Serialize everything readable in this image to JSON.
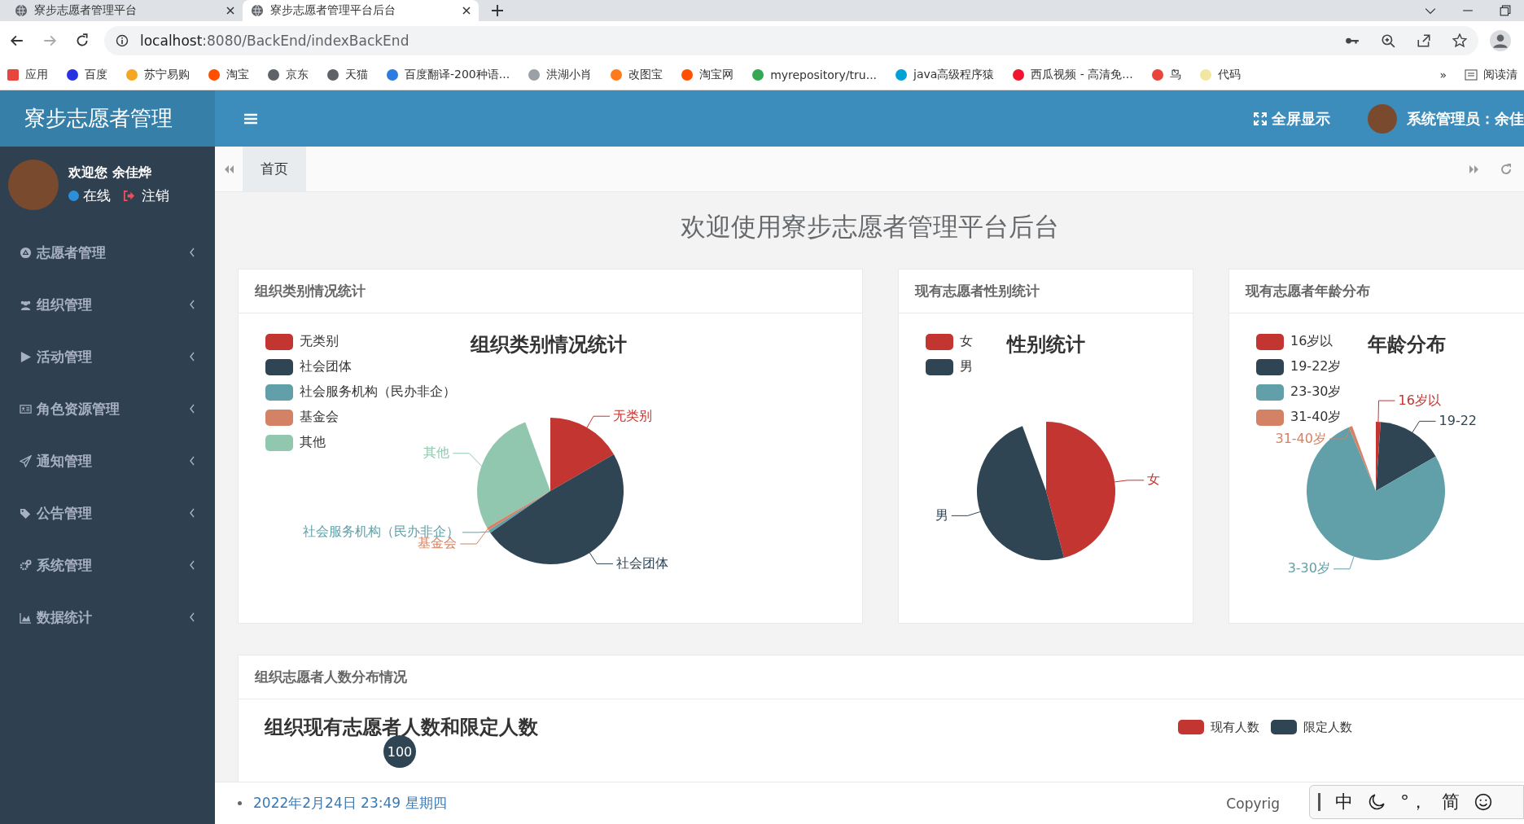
{
  "browser": {
    "tabs": [
      {
        "title": "寮步志愿者管理平台",
        "selected": false
      },
      {
        "title": "寮步志愿者管理平台后台",
        "selected": true
      }
    ],
    "url_host": "localhost",
    "url_rest": ":8080/BackEnd/indexBackEnd",
    "bookmarks": [
      {
        "label": "应用",
        "color": "#e8453c"
      },
      {
        "label": "百度",
        "color": "#2932e1"
      },
      {
        "label": "苏宁易购",
        "color": "#f5a623"
      },
      {
        "label": "淘宝",
        "color": "#ff5000"
      },
      {
        "label": "京东",
        "color": "#5f6368"
      },
      {
        "label": "天猫",
        "color": "#5f6368"
      },
      {
        "label": "百度翻译-200种语...",
        "color": "#2b7be0"
      },
      {
        "label": "洪湖小肖",
        "color": "#9aa0a6"
      },
      {
        "label": "改图宝",
        "color": "#ff7a1a"
      },
      {
        "label": "淘宝网",
        "color": "#ff5000"
      },
      {
        "label": "myrepository/tru...",
        "color": "#34a853"
      },
      {
        "label": "java高级程序猿",
        "color": "#00a1d6"
      },
      {
        "label": "西瓜视频 - 高清免...",
        "color": "#f0142f"
      },
      {
        "label": "鸟",
        "color": "#e8453c"
      },
      {
        "label": "代码",
        "color": "#f2e6a0"
      }
    ],
    "bookmarks_more": "»",
    "reading_list": "阅读清"
  },
  "app": {
    "logo": "寮步志愿者管理",
    "fullscreen": "全屏显示",
    "admin": "系统管理员：余佳"
  },
  "user": {
    "greeting": "欢迎您 余佳烨",
    "status": "在线",
    "logout": "注销"
  },
  "menu": [
    {
      "label": "志愿者管理"
    },
    {
      "label": "组织管理"
    },
    {
      "label": "活动管理"
    },
    {
      "label": "角色资源管理"
    },
    {
      "label": "通知管理"
    },
    {
      "label": "公告管理"
    },
    {
      "label": "系统管理"
    },
    {
      "label": "数据统计"
    }
  ],
  "page_tabs": [
    {
      "label": "首页",
      "selected": true
    }
  ],
  "welcome": "欢迎使用寮步志愿者管理平台后台",
  "pie_cards": [
    {
      "header": "组织类别情况统计",
      "chart_title": "组织类别情况统计",
      "legend": [
        {
          "label": "无类别",
          "color": "#c23531"
        },
        {
          "label": "社会团体",
          "color": "#2f4554"
        },
        {
          "label": "社会服务机构（民办非企）",
          "color": "#61a0a8"
        },
        {
          "label": "基金会",
          "color": "#d48265"
        },
        {
          "label": "其他",
          "color": "#91c7ae"
        }
      ],
      "slices": [
        {
          "label": "无类别",
          "color": "#c23531"
        },
        {
          "label": "其他",
          "color": "#91c7ae"
        },
        {
          "label": "社会服务机构（民办非企）",
          "color": "#61a0a8"
        },
        {
          "label": "基金会",
          "color": "#d48265"
        },
        {
          "label": "社会团体",
          "color": "#2f4554"
        }
      ]
    },
    {
      "header": "现有志愿者性别统计",
      "chart_title": "性别统计",
      "legend": [
        {
          "label": "女",
          "color": "#c23531"
        },
        {
          "label": "男",
          "color": "#2f4554"
        }
      ],
      "slices": [
        {
          "label": "女",
          "color": "#c23531"
        },
        {
          "label": "男",
          "color": "#2f4554"
        }
      ]
    },
    {
      "header": "现有志愿者年龄分布",
      "chart_title": "年龄分布",
      "legend": [
        {
          "label": "16岁以",
          "color": "#c23531"
        },
        {
          "label": "19-22岁",
          "color": "#2f4554"
        },
        {
          "label": "23-30岁",
          "color": "#61a0a8"
        },
        {
          "label": "31-40岁",
          "color": "#d48265"
        }
      ],
      "slices": [
        {
          "label": "16岁以",
          "color": "#c23531"
        },
        {
          "label": "19-22",
          "color": "#2f4554"
        },
        {
          "label": "3-30岁",
          "color": "#61a0a8"
        },
        {
          "label": "31-40岁",
          "color": "#d48265"
        }
      ]
    }
  ],
  "bar_card": {
    "header": "组织志愿者人数分布情况",
    "chart_title": "组织现有志愿者人数和限定人数",
    "legend": [
      {
        "label": "现有人数",
        "color": "#c23531"
      },
      {
        "label": "限定人数",
        "color": "#2f4554"
      }
    ],
    "data_label": "100"
  },
  "footer": {
    "date": "2022年2月24日 23:49 星期四",
    "copyright": "Copyrig"
  },
  "ime": {
    "mode": "中",
    "punct": "°，",
    "script": "简"
  }
}
